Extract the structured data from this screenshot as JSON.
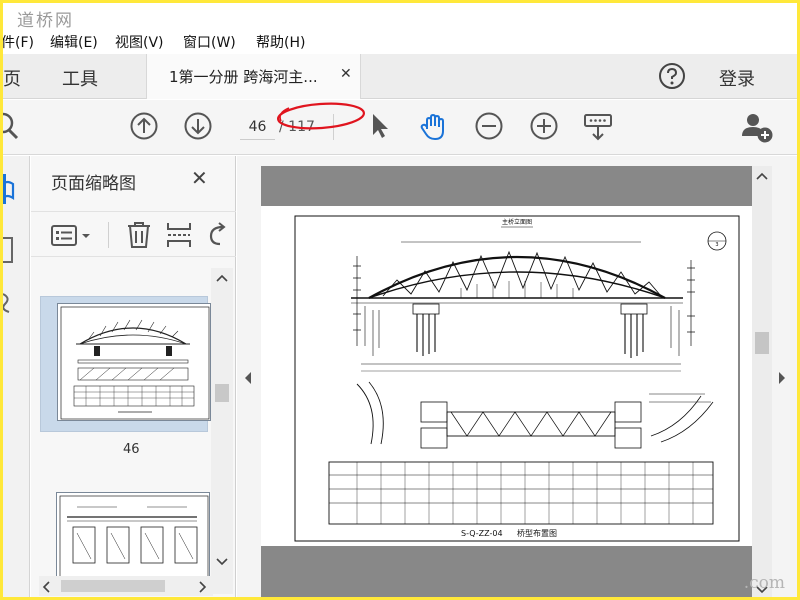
{
  "watermark": {
    "top": "道桥网",
    "bottom": ".com"
  },
  "menubar": {
    "items": [
      "件(F)",
      "编辑(E)",
      "视图(V)",
      "窗口(W)",
      "帮助(H)"
    ]
  },
  "tabbar": {
    "home": "主页",
    "tools": "工具",
    "active_tab": "1第一分册 跨海河主...",
    "close_glyph": "✕",
    "login": "登录"
  },
  "toolbar": {
    "current_page": "46",
    "total_pages": "/ 117",
    "annotation_color": "#e0141e",
    "active_tool_color": "#1a73d8"
  },
  "thumbnails": {
    "title": "页面缩略图",
    "close_glyph": "✕",
    "page_label": "46"
  },
  "document": {
    "drawing_title": "主桥立面图",
    "drawing_number": "S-Q-ZZ-04",
    "drawing_name": "桥型布置图",
    "detail_marker": "3"
  },
  "icons": [
    "search-icon",
    "page-up-icon",
    "page-down-icon",
    "select-cursor-icon",
    "hand-tool-icon",
    "zoom-out-icon",
    "zoom-in-icon",
    "marquee-zoom-icon",
    "add-user-icon",
    "help-icon",
    "bookmark-icon",
    "layers-icon",
    "attachment-icon",
    "thumbnail-options-icon",
    "delete-icon",
    "insert-page-icon",
    "rotate-icon"
  ]
}
